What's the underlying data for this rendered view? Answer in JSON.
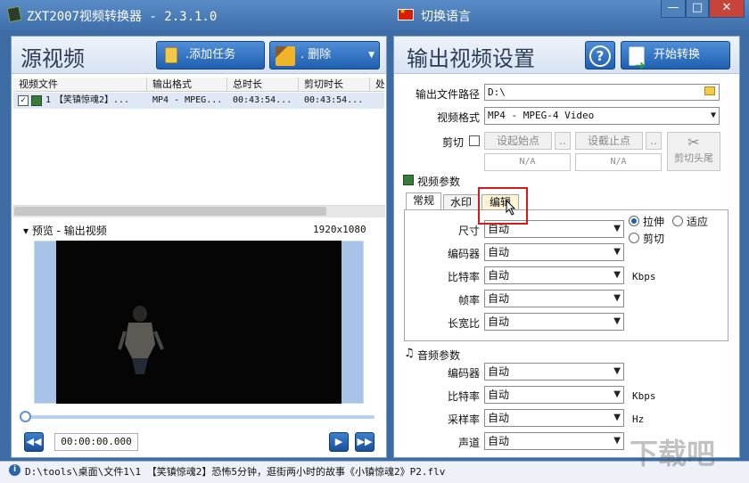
{
  "titlebar": {
    "app_title": "ZXT2007视频转换器 - 2.3.1.0",
    "language_label": "切换语言",
    "minimize": "—",
    "maximize": "□",
    "close": "✕"
  },
  "source": {
    "title": "源视频",
    "add_task": ".添加任务",
    "delete": ".   删除",
    "columns": [
      "视频文件",
      "输出格式",
      "总时长",
      "剪切时长",
      "处"
    ],
    "rows": [
      {
        "index": "1",
        "file": "【笑镇惊魂2】...",
        "format": "MP4 - MPEG...",
        "duration": "00:43:54...",
        "cut_duration": "00:43:54..."
      }
    ]
  },
  "preview": {
    "label": "▾ 预览 - 输出视频",
    "resolution": "1920x1080",
    "timecode": "00:00:00.000",
    "prev_frame": "◀◀",
    "play": "▶",
    "next_frame": "▶▶"
  },
  "output": {
    "title": "输出视频设置",
    "start_convert": "开始转换",
    "path_label": "输出文件路径",
    "path_value": "D:\\",
    "format_label": "视频格式",
    "format_value": "MP4 - MPEG-4 Video",
    "cut_label": "剪切",
    "set_start": "设起始点",
    "set_end": "设截止点",
    "more": "..",
    "start_value": "N/A",
    "end_value": "N/A",
    "cut_ends": "剪切头尾",
    "video_params": "视频参数",
    "tabs": [
      "常规",
      "水印",
      "编辑"
    ],
    "size_label": "尺寸",
    "encoder_label": "编码器",
    "bitrate_label": "比特率",
    "fps_label": "帧率",
    "aspect_label": "长宽比",
    "auto": "自动",
    "kbps": "Kbps",
    "radio_stretch": "拉伸",
    "radio_fit": "适应",
    "radio_crop": "剪切",
    "audio_params": "音频参数",
    "a_encoder_label": "编码器",
    "a_bitrate_label": "比特率",
    "a_samplerate_label": "采样率",
    "a_channel_label": "声道",
    "hz": "Hz"
  },
  "status": {
    "text": "D:\\tools\\桌面\\文件1\\1 【笑镇惊魂2】恐怖5分钟，逛街两小时的故事《小镇惊魂2》P2.flv"
  },
  "watermark": "下载吧",
  "colors": {
    "accent": "#1f5fb0",
    "highlight": "#d51a1a",
    "titlebar": "#4a7cba"
  }
}
